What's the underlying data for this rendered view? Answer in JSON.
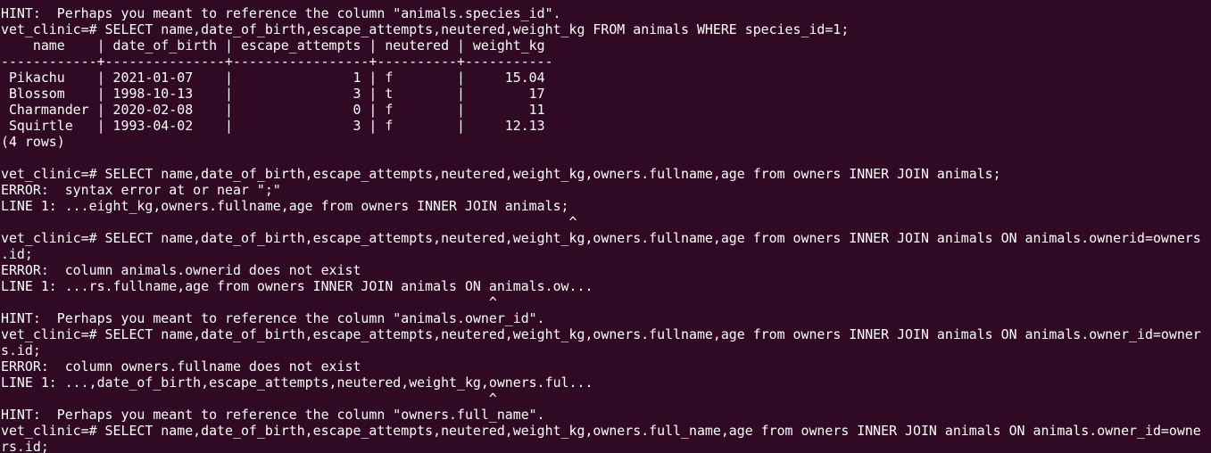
{
  "terminal": {
    "lines": [
      "HINT:  Perhaps you meant to reference the column \"animals.species_id\".",
      "vet_clinic=# SELECT name,date_of_birth,escape_attempts,neutered,weight_kg FROM animals WHERE species_id=1;",
      "    name    | date_of_birth | escape_attempts | neutered | weight_kg",
      "------------+---------------+-----------------+----------+-----------",
      " Pikachu    | 2021-01-07    |               1 | f        |     15.04",
      " Blossom    | 1998-10-13    |               3 | t        |        17",
      " Charmander | 2020-02-08    |               0 | f        |        11",
      " Squirtle   | 1993-04-02    |               3 | f        |     12.13",
      "(4 rows)",
      "",
      "vet_clinic=# SELECT name,date_of_birth,escape_attempts,neutered,weight_kg,owners.fullname,age from owners INNER JOIN animals;",
      "ERROR:  syntax error at or near \";\"",
      "LINE 1: ...eight_kg,owners.fullname,age from owners INNER JOIN animals;",
      "                                                                       ^",
      "vet_clinic=# SELECT name,date_of_birth,escape_attempts,neutered,weight_kg,owners.fullname,age from owners INNER JOIN animals ON animals.ownerid=owners",
      ".id;",
      "ERROR:  column animals.ownerid does not exist",
      "LINE 1: ...rs.fullname,age from owners INNER JOIN animals ON animals.ow...",
      "                                                             ^",
      "HINT:  Perhaps you meant to reference the column \"animals.owner_id\".",
      "vet_clinic=# SELECT name,date_of_birth,escape_attempts,neutered,weight_kg,owners.fullname,age from owners INNER JOIN animals ON animals.owner_id=owner",
      "s.id;",
      "ERROR:  column owners.fullname does not exist",
      "LINE 1: ...,date_of_birth,escape_attempts,neutered,weight_kg,owners.ful...",
      "                                                             ^",
      "HINT:  Perhaps you meant to reference the column \"owners.full_name\".",
      "vet_clinic=# SELECT name,date_of_birth,escape_attempts,neutered,weight_kg,owners.full_name,age from owners INNER JOIN animals ON animals.owner_id=owne",
      "rs.id;"
    ]
  }
}
